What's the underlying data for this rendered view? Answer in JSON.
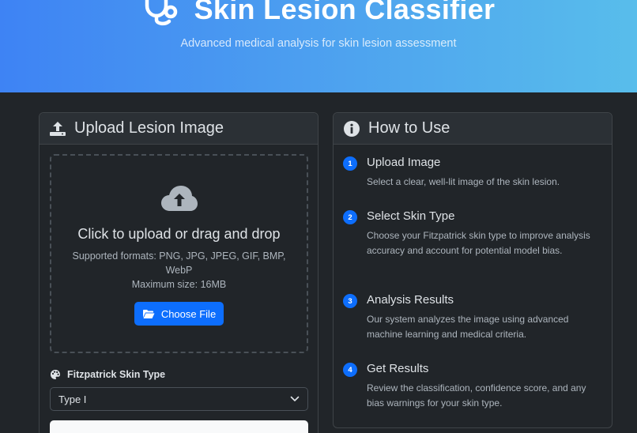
{
  "header": {
    "title": "Skin Lesion Classifier",
    "subtitle": "Advanced medical analysis for skin lesion assessment",
    "icon": "stethoscope-icon"
  },
  "upload": {
    "title": "Upload Lesion Image",
    "icon": "upload-icon",
    "dropzone_title": "Click to upload or drag and drop",
    "formats": "Supported formats: PNG, JPG, JPEG, GIF, BMP, WebP",
    "max_size": "Maximum size: 16MB",
    "choose_label": "Choose File",
    "skin_label": "Fitzpatrick Skin Type",
    "skin_value": "Type I"
  },
  "howto": {
    "title": "How to Use",
    "icon": "info-icon",
    "steps": [
      {
        "num": "1",
        "title": "Upload Image",
        "desc": "Select a clear, well-lit image of the skin lesion."
      },
      {
        "num": "2",
        "title": "Select Skin Type",
        "desc": "Choose your Fitzpatrick skin type to improve analysis accuracy and account for potential model bias."
      },
      {
        "num": "3",
        "title": "Analysis Results",
        "desc": "Our system analyzes the image using advanced machine learning and medical criteria."
      },
      {
        "num": "4",
        "title": "Get Results",
        "desc": "Review the classification, confidence score, and any bias warnings for your skin type."
      }
    ]
  },
  "colors": {
    "primary": "#0d6efd",
    "background": "#212529",
    "hero_start": "#3e83f4",
    "hero_end": "#58bdeb"
  }
}
